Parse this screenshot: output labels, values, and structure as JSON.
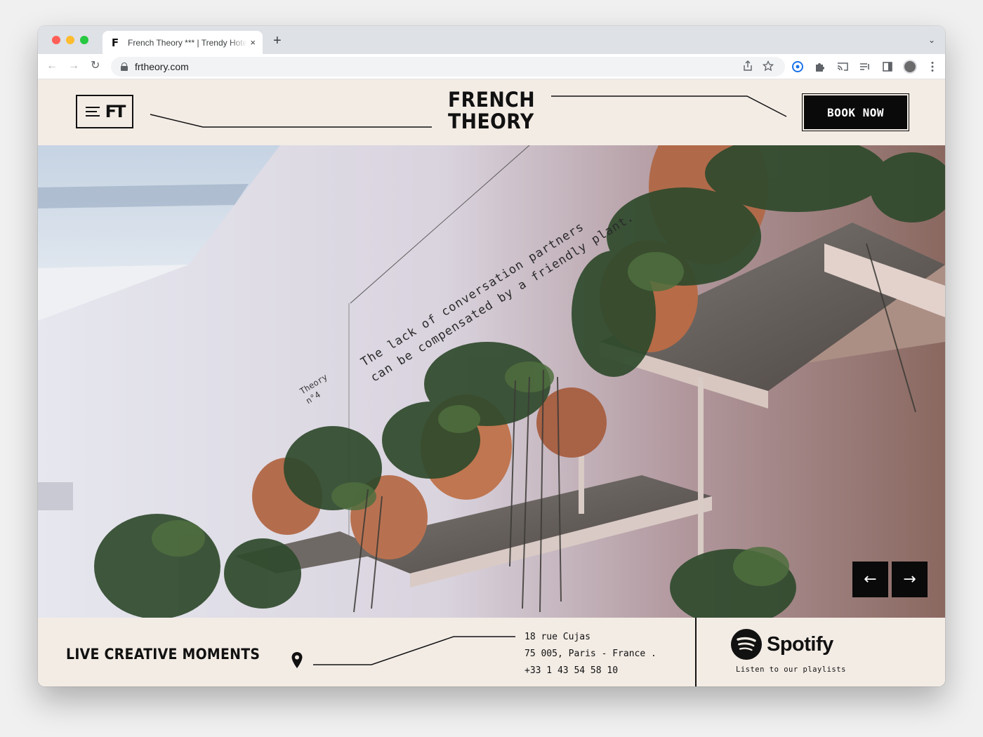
{
  "browser": {
    "tab_favicon": "F",
    "tab_title": "French Theory *** | Trendy Hotel",
    "tab_close": "×",
    "new_tab": "+",
    "tab_menu": "⌄",
    "url": "frtheory.com",
    "nav": {
      "back": "←",
      "forward": "→",
      "reload": "↻"
    },
    "icons": [
      "share-icon",
      "star-icon",
      "password-icon",
      "puzzle-extension-icon",
      "cast-icon",
      "media-queue-icon",
      "sidebar-icon",
      "profile-avatar",
      "kebab-menu-icon"
    ]
  },
  "header": {
    "logo_line1": "FRENCH",
    "logo_line2": "THEORY",
    "menu_mark": "FT",
    "book_label": "BOOK NOW"
  },
  "hero": {
    "quote_line1": "The lack of conversation partners",
    "quote_line2": "can be compensated by a friendly plant.",
    "theory_line1": "Theory",
    "theory_line2": "n°4",
    "prev_arrow": "←",
    "next_arrow": "→"
  },
  "info": {
    "tagline": "LIVE CREATIVE MOMENTS",
    "address_line1": "18 rue Cujas",
    "address_line2": "75 005, Paris - France .",
    "phone": "+33 1 43 54 58 10",
    "spotify_name": "Spotify",
    "spotify_caption": "Listen to our playlists"
  },
  "colors": {
    "page_bg": "#f3ece5",
    "ink": "#111111",
    "button_bg": "#0a0a0a"
  }
}
